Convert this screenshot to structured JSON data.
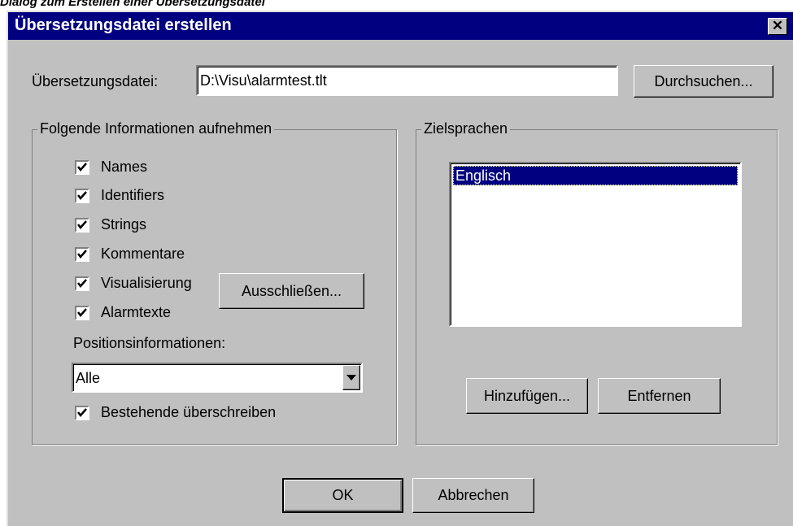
{
  "caption": "Dialog zum Erstellen einer Übersetzungsdatei",
  "window": {
    "title": "Übersetzungsdatei erstellen",
    "close_glyph": "✕"
  },
  "file": {
    "label": "Übersetzungsdatei:",
    "value": "D:\\Visu\\alarmtest.tlt",
    "browse_label": "Durchsuchen..."
  },
  "info_group": {
    "legend": "Folgende Informationen aufnehmen",
    "checkboxes": [
      {
        "label": "Names",
        "checked": true
      },
      {
        "label": "Identifiers",
        "checked": true
      },
      {
        "label": "Strings",
        "checked": true
      },
      {
        "label": "Kommentare",
        "checked": true
      },
      {
        "label": "Visualisierung",
        "checked": true
      },
      {
        "label": "Alarmtexte",
        "checked": true
      }
    ],
    "exclude_label": "Ausschließen...",
    "position_label": "Positionsinformationen:",
    "position_value": "Alle",
    "overwrite_label": "Bestehende überschreiben",
    "overwrite_checked": true
  },
  "languages": {
    "legend": "Zielsprachen",
    "items": [
      "Englisch"
    ],
    "add_label": "Hinzufügen...",
    "remove_label": "Entfernen"
  },
  "footer": {
    "ok_label": "OK",
    "cancel_label": "Abbrechen"
  },
  "colors": {
    "face": "#c0c0c0",
    "titlebar": "#000080",
    "selection": "#000080"
  }
}
